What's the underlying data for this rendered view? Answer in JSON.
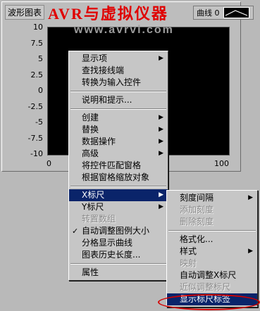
{
  "graph": {
    "label": "波形图表",
    "watermark_title": "AVR与虚拟仪器",
    "watermark_url": "www.avrvi.com",
    "legend_label": "曲线 0",
    "y_ticks": [
      "10",
      "7.5",
      "5",
      "2.5",
      "0",
      "-2.5",
      "-5",
      "-7.5",
      "-10"
    ],
    "x_ticks": [
      "0",
      "100"
    ],
    "plot_background": "#000000"
  },
  "context_menu": {
    "items": [
      {
        "label": "显示项",
        "submenu": true
      },
      {
        "label": "查找接线端"
      },
      {
        "label": "转换为输入控件"
      },
      {
        "sep": true
      },
      {
        "label": "说明和提示..."
      },
      {
        "sep": true
      },
      {
        "label": "创建",
        "submenu": true
      },
      {
        "label": "替换",
        "submenu": true
      },
      {
        "label": "数据操作",
        "submenu": true
      },
      {
        "label": "高级",
        "submenu": true
      },
      {
        "label": "将控件匹配窗格"
      },
      {
        "label": "根据窗格缩放对象"
      },
      {
        "sep": true
      },
      {
        "label": "X标尺",
        "submenu": true,
        "selected": true
      },
      {
        "label": "Y标尺",
        "submenu": true
      },
      {
        "label": "转置数组",
        "disabled": true
      },
      {
        "label": "自动调整图例大小",
        "checked": true
      },
      {
        "label": "分格显示曲线"
      },
      {
        "label": "图表历史长度..."
      },
      {
        "sep": true
      },
      {
        "label": "属性"
      }
    ]
  },
  "x_scale_submenu": {
    "items": [
      {
        "label": "刻度间隔",
        "submenu": true
      },
      {
        "label": "添加刻度",
        "disabled": true
      },
      {
        "label": "删除刻度",
        "disabled": true
      },
      {
        "sep": true
      },
      {
        "label": "格式化..."
      },
      {
        "label": "样式",
        "submenu": true
      },
      {
        "label": "映射",
        "disabled": true
      },
      {
        "label": "自动调整X标尺"
      },
      {
        "label": "近似调整标尺",
        "disabled": true
      },
      {
        "label": "显示标尺标签",
        "selected": true
      }
    ]
  },
  "colors": {
    "menu_highlight": "#0a246a",
    "annotation_red": "#d40000",
    "watermark_red": "#e00000"
  }
}
